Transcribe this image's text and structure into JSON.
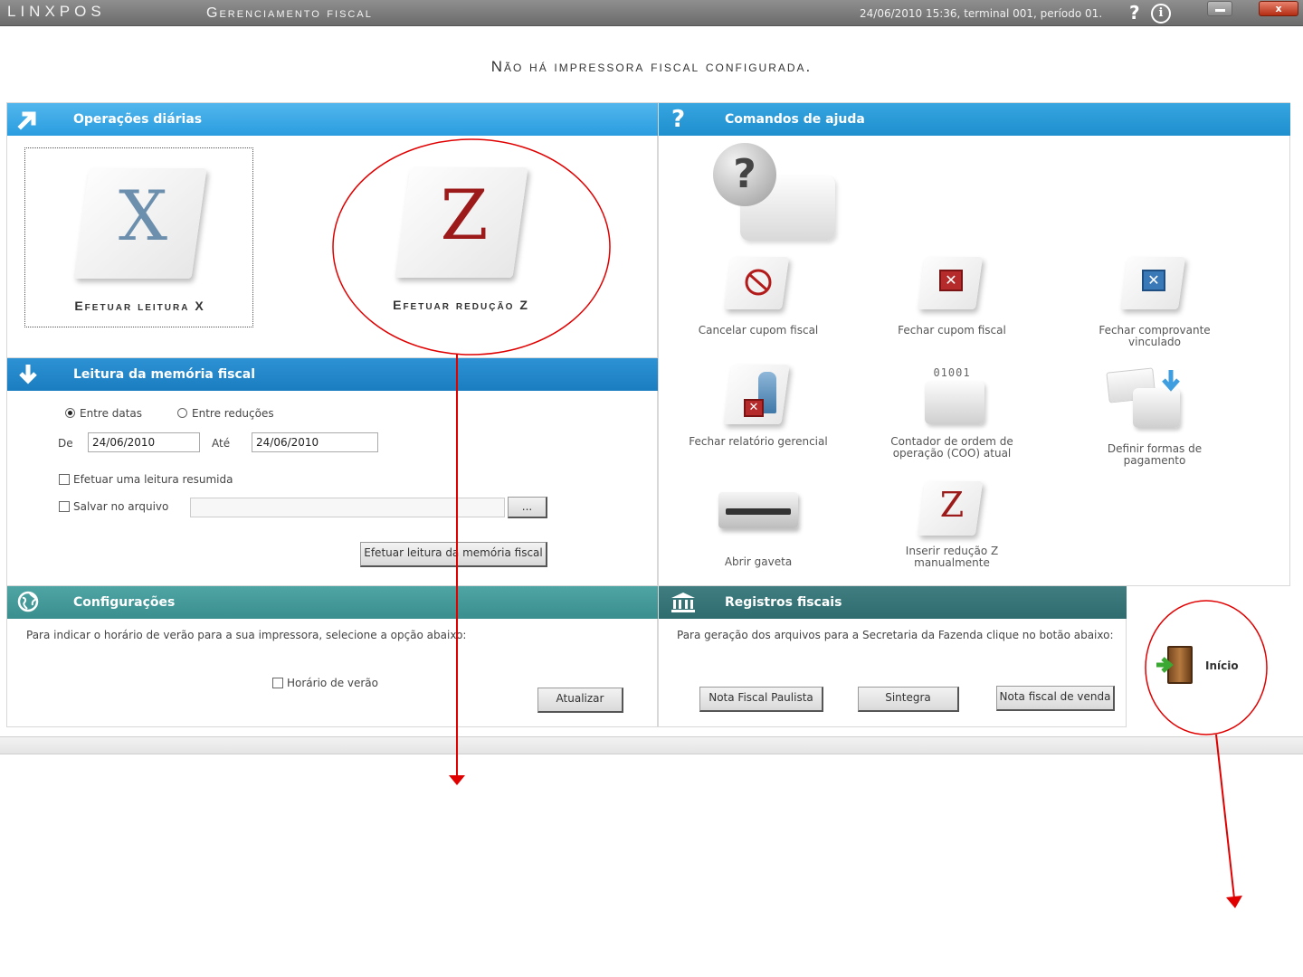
{
  "titlebar": {
    "logo": "LINXPOS",
    "title": "Gerenciamento fiscal",
    "status": "24/06/2010 15:36, terminal 001, período 01.",
    "help_glyph": "?",
    "info_glyph": "i",
    "close_glyph": "x"
  },
  "message": "Não há impressora fiscal configurada.",
  "daily": {
    "header": "Operações diárias",
    "leitura_x": {
      "letter": "X",
      "label": "Efetuar leitura X"
    },
    "reducao_z": {
      "letter": "Z",
      "label": "Efetuar redução Z"
    }
  },
  "memoria": {
    "header": "Leitura da memória fiscal",
    "radio_datas": "Entre datas",
    "radio_reducoes": "Entre reduções",
    "de_label": "De",
    "de_value": "24/06/2010",
    "ate_label": "Até",
    "ate_value": "24/06/2010",
    "resumida_label": "Efetuar uma leitura resumida",
    "salvar_label": "Salvar no arquivo",
    "browse_label": "...",
    "submit_label": "Efetuar leitura da memória fiscal"
  },
  "ajuda": {
    "header": "Comandos de ajuda",
    "items": [
      {
        "label": "Cancelar cupom fiscal"
      },
      {
        "label": "Fechar cupom fiscal"
      },
      {
        "label": "Fechar comprovante vinculado"
      },
      {
        "label": "Fechar relatório gerencial"
      },
      {
        "label": "Contador de ordem de operação (COO) atual",
        "digits": "01001"
      },
      {
        "label": "Definir formas de pagamento"
      },
      {
        "label": "Abrir gaveta"
      },
      {
        "label": "Inserir redução Z manualmente",
        "letter": "Z"
      }
    ]
  },
  "config": {
    "header": "Configurações",
    "desc": "Para indicar o horário de verão para a sua impressora, selecione a opção abaixo:",
    "horario_label": "Horário de verão",
    "update_label": "Atualizar"
  },
  "registros": {
    "header": "Registros fiscais",
    "desc": "Para geração dos arquivos para a Secretaria da Fazenda clique no botão abaixo:",
    "btn_paulista": "Nota Fiscal Paulista",
    "btn_sintegra": "Sintegra",
    "btn_venda": "Nota fiscal de venda"
  },
  "inicio": {
    "label": "Início"
  },
  "colors": {
    "annotation": "#e00000",
    "accent_blue": "#2a9de0",
    "accent_teal": "#3a8e8e"
  }
}
